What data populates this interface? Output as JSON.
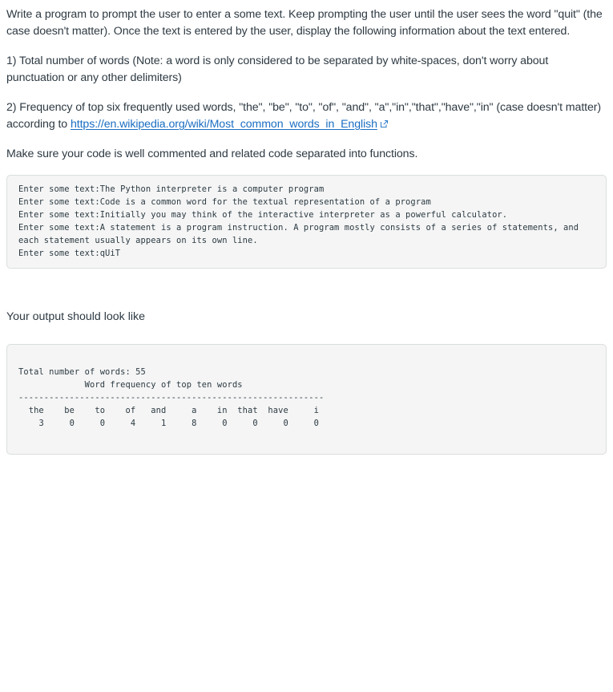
{
  "assignment": {
    "intro": "Write a program to prompt the user to enter a some text. Keep prompting the user until the user sees the word \"quit\" (the case doesn't matter). Once the text is entered by the user, display the following information about the text entered.",
    "requirement_1": "1) Total number of words (Note: a word is only considered to be separated by white-spaces, don't worry about punctuation or any other delimiters)",
    "requirement_2_prefix": "2) Frequency of top six frequently used words, \"the\", \"be\", \"to\", \"of\", \"and\", \"a\",\"in\",\"that\",\"have\",\"in\"  (case doesn't matter) according to ",
    "link_text": "https://en.wikipedia.org/wiki/Most_common_words_in_English",
    "link_icon": "external-link-icon",
    "requirement_3": "Make sure your code is well commented and related code separated into functions.",
    "output_heading": "Your output should look like"
  },
  "sample_session": {
    "lines": "Enter some text:The Python interpreter is a computer program\nEnter some text:Code is a common word for the textual representation of a program\nEnter some text:Initially you may think of the interactive interpreter as a powerful calculator.\nEnter some text:A statement is a program instruction. A program mostly consists of a series of statements, and each statement usually appears on its own line.\nEnter some text:qUiT"
  },
  "expected_output": {
    "total_words_line": "Total number of words: 55",
    "table_title": "Word frequency of top ten words",
    "separator": "------------------------------------------------------------",
    "words": [
      "the",
      "be",
      "to",
      "of",
      "and",
      "a",
      "in",
      "that",
      "have",
      "i"
    ],
    "counts": [
      3,
      0,
      0,
      4,
      1,
      8,
      0,
      0,
      0,
      0
    ],
    "rendered": "Total number of words: 55\n             Word frequency of top ten words\n------------------------------------------------------------\n  the    be    to    of   and     a    in  that  have     i\n    3     0     0     4     1     8     0     0     0     0"
  },
  "colors": {
    "text": "#2e3a43",
    "link": "#1b6ec2",
    "code_background": "#f5f5f5",
    "code_border": "#dadedf",
    "page_background": "#ffffff"
  }
}
